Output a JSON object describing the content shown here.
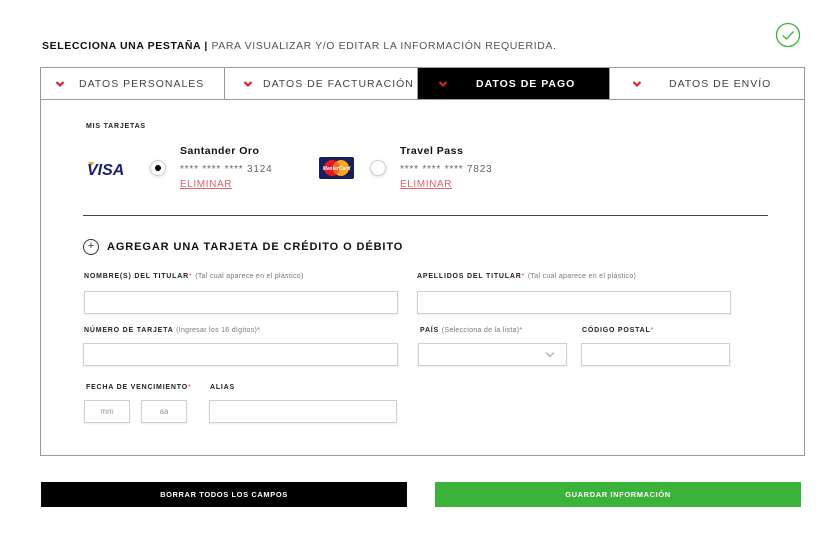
{
  "status": {
    "icon": "check-circle-icon",
    "color": "#3bb33a"
  },
  "instruction": {
    "bold": "SELECCIONA UNA PESTAÑA |",
    "normal": "PARA VISUALIZAR Y/O EDITAR LA INFORMACIÓN REQUERIDA."
  },
  "tabs": [
    {
      "label": "DATOS PERSONALES",
      "icon": "chevron-down-icon"
    },
    {
      "label": "DATOS DE FACTURACIÓN",
      "icon": "chevron-down-icon"
    },
    {
      "label": "DATOS DE PAGO",
      "icon": "chevron-down-icon",
      "active": true
    },
    {
      "label": "DATOS DE ENVÍO",
      "icon": "chevron-down-icon"
    }
  ],
  "cards_section": {
    "title": "MIS TARJETAS",
    "cards": [
      {
        "brand": "VISA",
        "brand_icon": "visa-logo",
        "name": "Santander Oro",
        "number": "**** **** **** 3124",
        "delete_label": "ELIMINAR",
        "selected": true
      },
      {
        "brand": "MasterCard",
        "brand_icon": "mastercard-logo",
        "name": "Travel Pass",
        "number": "**** **** **** 7823",
        "delete_label": "ELIMINAR",
        "selected": false
      }
    ]
  },
  "add_card": {
    "icon": "plus-circle-icon",
    "title": "AGREGAR UNA TARJETA DE CRÉDITO O DÉBITO"
  },
  "form": {
    "first_name": {
      "label": "NOMBRE(S) DEL TITULAR",
      "required": "*",
      "hint": "(Tal cual aparece en el plástico)",
      "value": ""
    },
    "last_name": {
      "label": "APELLIDOS DEL TITULAR",
      "required": "*",
      "hint": "(Tal cual aparece en el plástico)",
      "value": ""
    },
    "card_number": {
      "label": "NÚMERO DE TARJETA",
      "hint": "(Ingresar los 16 dígitos)*",
      "value": ""
    },
    "country": {
      "label": "PAÍS",
      "hint": "(Selecciona de la lista)*",
      "value": ""
    },
    "postal_code": {
      "label": "CÓDIGO POSTAL",
      "required": "*",
      "value": ""
    },
    "expiration": {
      "label": "FECHA DE VENCIMIENTO",
      "required": "*",
      "month_placeholder": "mm",
      "year_placeholder": "aa"
    },
    "alias": {
      "label": "ALIAS",
      "value": ""
    }
  },
  "buttons": {
    "clear": "BORRAR TODOS LOS CAMPOS",
    "save": "GUARDAR INFORMACIÓN"
  },
  "colors": {
    "accent_red": "#d0242f",
    "save_green": "#3bb33a",
    "active_tab": "#000000"
  }
}
